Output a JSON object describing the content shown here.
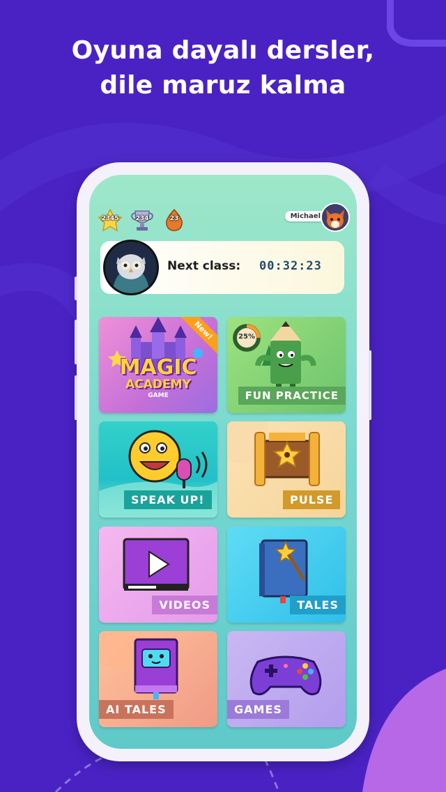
{
  "headline": {
    "line1": "Oyuna dayalı dersler,",
    "line2": "dile maruz kalma"
  },
  "stats": [
    {
      "icon": "star-icon",
      "value": "2345"
    },
    {
      "icon": "trophy-icon",
      "value": "234"
    },
    {
      "icon": "drop-icon",
      "value": "23"
    }
  ],
  "user": {
    "name": "Michael",
    "avatar": "fox-avatar-icon"
  },
  "next_class": {
    "label": "Next class:",
    "time": "00:32:23",
    "avatar": "owl-teacher-icon"
  },
  "cards": [
    {
      "id": "magic-academy",
      "title_line1": "MAGIC",
      "title_line2": "ACADEMY",
      "title_line3": "GAME",
      "badge": "New!"
    },
    {
      "id": "fun-practice",
      "label": "FUN PRACTICE",
      "progress_text": "25%",
      "progress": 0.25
    },
    {
      "id": "speak-up",
      "label": "SPEAK UP!"
    },
    {
      "id": "pulse",
      "label": "PULSE"
    },
    {
      "id": "videos",
      "label": "VIDEOS"
    },
    {
      "id": "tales",
      "label": "TALES"
    },
    {
      "id": "ai-tales",
      "label": "AI TALES"
    },
    {
      "id": "games",
      "label": "GAMES"
    }
  ],
  "colors": {
    "background": "#4a22c4",
    "accent_purple": "#7b2fd8",
    "accent_orange": "#ff9e1a",
    "label_green": "#5aa65a",
    "label_teal": "#1aa39a",
    "label_gold": "#d19a2b",
    "label_pink": "#c77ad6",
    "label_cyan": "#1f9fc9",
    "label_salmon": "#c9735c",
    "label_lilac": "#9b7ad9"
  }
}
